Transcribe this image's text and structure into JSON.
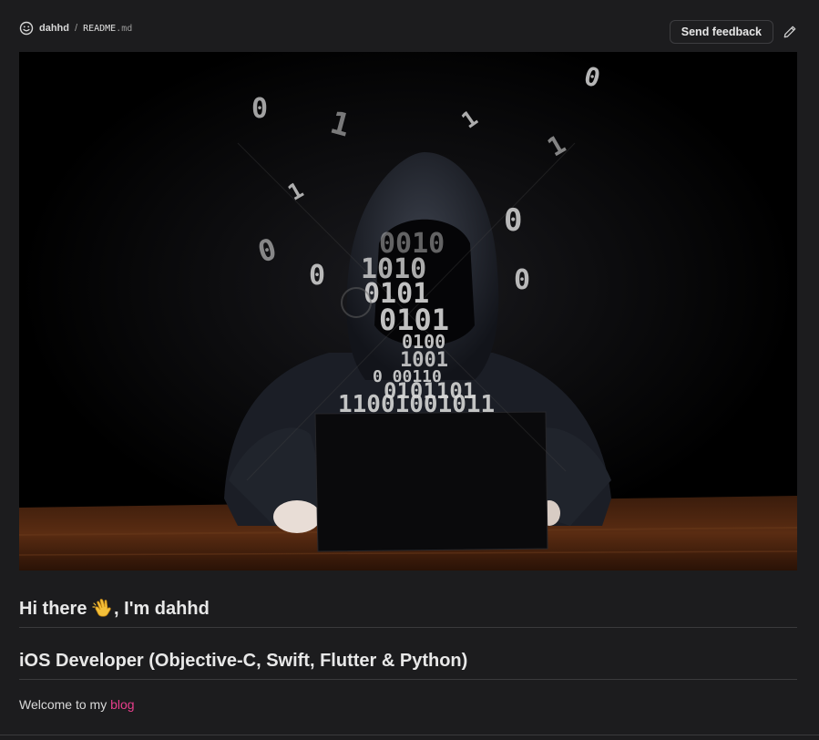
{
  "header": {
    "owner": "dahhd",
    "separator": "/",
    "file_name": "README",
    "file_ext": ".md",
    "icon": "smiley-icon",
    "feedback_label": "Send feedback",
    "edit_icon": "pencil-icon"
  },
  "banner": {
    "subject": "hooded hacker at laptop with binary digits"
  },
  "content": {
    "heading1_before": "Hi there ",
    "heading1_emoji": "waving-hand",
    "heading1_after": ", I'm dahhd",
    "heading2": "iOS Developer (Objective-C, Swift,  Flutter & Python)",
    "welcome_text": "Welcome to my ",
    "blog_link": "blog"
  },
  "colors": {
    "background": "#1c1c1e",
    "link": "#e83e8c",
    "border": "#3a3a3c"
  }
}
